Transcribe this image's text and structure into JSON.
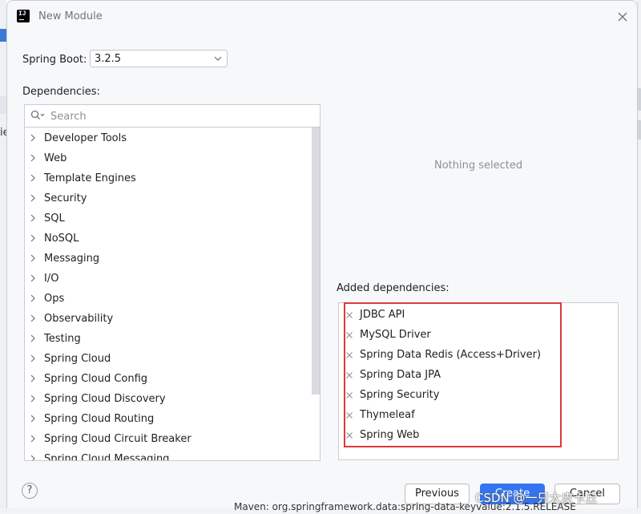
{
  "window": {
    "title": "New Module"
  },
  "spring_boot": {
    "label": "Spring Boot:",
    "value": "3.2.5"
  },
  "dependencies": {
    "label": "Dependencies:",
    "search_placeholder": "Search",
    "categories": [
      "Developer Tools",
      "Web",
      "Template Engines",
      "Security",
      "SQL",
      "NoSQL",
      "Messaging",
      "I/O",
      "Ops",
      "Observability",
      "Testing",
      "Spring Cloud",
      "Spring Cloud Config",
      "Spring Cloud Discovery",
      "Spring Cloud Routing",
      "Spring Cloud Circuit Breaker",
      "Spring Cloud Messaging"
    ]
  },
  "details": {
    "empty_text": "Nothing selected"
  },
  "added": {
    "label": "Added dependencies:",
    "items": [
      "JDBC API",
      "MySQL Driver",
      "Spring Data Redis (Access+Driver)",
      "Spring Data JPA",
      "Spring Security",
      "Thymeleaf",
      "Spring Web"
    ]
  },
  "buttons": {
    "help": "?",
    "previous": "Previous",
    "create": "Create",
    "cancel": "Cancel"
  },
  "background": {
    "left_char": "ie",
    "maven_text": "Maven: org.springframework.data:spring-data-keyvalue:2.1.5.RELEASE"
  },
  "watermark": "CSDN @一只大皮卡丘",
  "colors": {
    "accent": "#3574f0",
    "highlight": "#e0393c"
  }
}
